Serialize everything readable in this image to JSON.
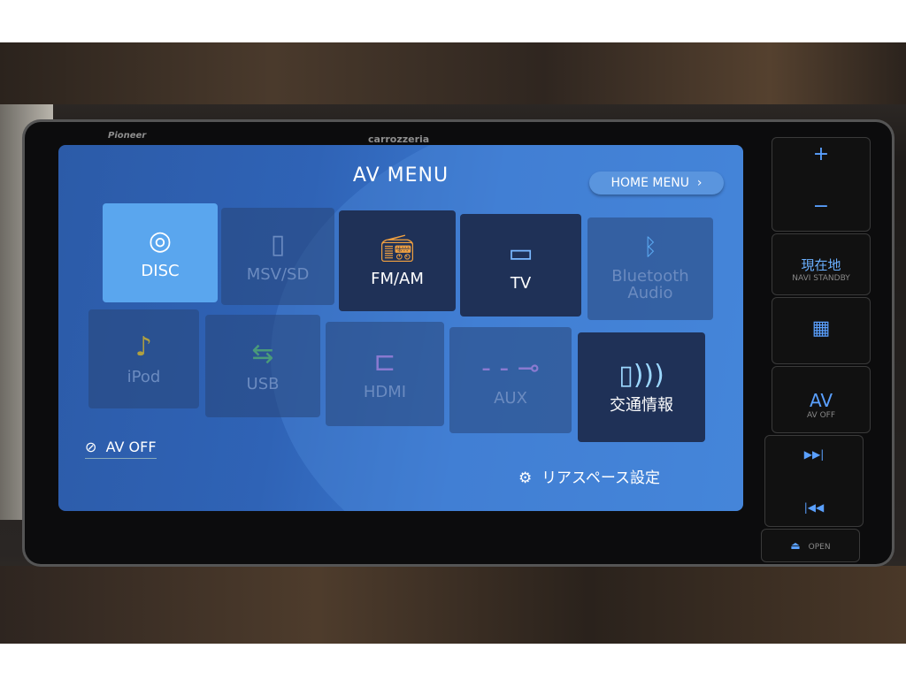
{
  "bezel": {
    "brand_left": "Pioneer",
    "brand_center": "carrozzeria"
  },
  "screen": {
    "title": "AV MENU",
    "home_menu_label": "HOME MENU",
    "home_menu_icon": "chevron-right-icon",
    "tiles": [
      {
        "label": "DISC",
        "icon": "disc-icon",
        "state": "selected"
      },
      {
        "label": "MSV/SD",
        "icon": "sd-card-icon",
        "state": "disabled"
      },
      {
        "label": "FM/AM",
        "icon": "radio-icon",
        "state": "enabled"
      },
      {
        "label": "TV",
        "icon": "tv-icon",
        "state": "enabled"
      },
      {
        "label": "Bluetooth Audio",
        "icon": "bluetooth-icon",
        "state": "disabled"
      },
      {
        "label": "iPod",
        "icon": "music-note-icon",
        "state": "disabled"
      },
      {
        "label": "USB",
        "icon": "usb-icon",
        "state": "disabled"
      },
      {
        "label": "HDMI",
        "icon": "hdmi-icon",
        "state": "disabled"
      },
      {
        "label": "AUX",
        "icon": "aux-cable-icon",
        "state": "disabled"
      },
      {
        "label": "交通情報",
        "icon": "traffic-signal-icon",
        "state": "enabled"
      }
    ],
    "av_off_label": "AV OFF",
    "rear_space_label": "リアスペース設定"
  },
  "hardware_buttons": {
    "vol_up": "+",
    "vol_down": "−",
    "current_location": "現在地",
    "current_location_sub": "NAVI STANDBY",
    "av": "AV",
    "av_sub": "AV OFF",
    "open": "OPEN"
  },
  "colors": {
    "accent": "#5aa6ee",
    "screen_bg": "#2f63b6",
    "button_glow": "#5aa0ff"
  }
}
